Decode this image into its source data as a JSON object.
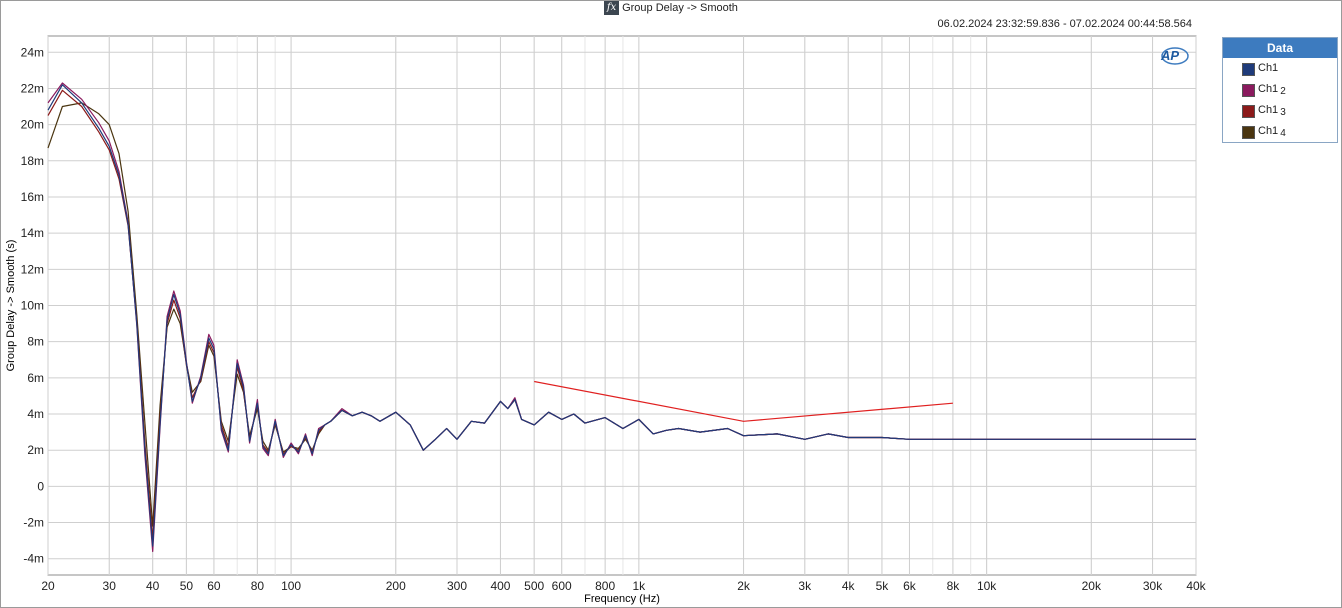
{
  "window": {
    "title": "Group Delay -> Smooth",
    "fx_icon": "fx",
    "timestamp": "06.02.2024 23:32:59.836 - 07.02.2024 00:44:58.564"
  },
  "logo": {
    "text": "AP"
  },
  "legend": {
    "header": "Data",
    "items": [
      {
        "label": "Ch1",
        "index": "",
        "color": "#1f3b7a"
      },
      {
        "label": "Ch1",
        "index": "2",
        "color": "#8a1a5e"
      },
      {
        "label": "Ch1",
        "index": "3",
        "color": "#8b1a1a"
      },
      {
        "label": "Ch1",
        "index": "4",
        "color": "#4a3510"
      }
    ]
  },
  "chart_data": {
    "type": "line",
    "xscale": "log",
    "xlabel": "Frequency (Hz)",
    "ylabel": "Group Delay -> Smooth (s)",
    "xlim": [
      20,
      40000
    ],
    "ylim": [
      -0.0049,
      0.0249
    ],
    "x_ticks": [
      {
        "v": 20,
        "l": "20"
      },
      {
        "v": 30,
        "l": "30"
      },
      {
        "v": 40,
        "l": "40"
      },
      {
        "v": 50,
        "l": "50"
      },
      {
        "v": 60,
        "l": "60"
      },
      {
        "v": 80,
        "l": "80"
      },
      {
        "v": 100,
        "l": "100"
      },
      {
        "v": 200,
        "l": "200"
      },
      {
        "v": 300,
        "l": "300"
      },
      {
        "v": 400,
        "l": "400"
      },
      {
        "v": 500,
        "l": "500"
      },
      {
        "v": 600,
        "l": "600"
      },
      {
        "v": 800,
        "l": "800"
      },
      {
        "v": 1000,
        "l": "1k"
      },
      {
        "v": 2000,
        "l": "2k"
      },
      {
        "v": 3000,
        "l": "3k"
      },
      {
        "v": 4000,
        "l": "4k"
      },
      {
        "v": 5000,
        "l": "5k"
      },
      {
        "v": 6000,
        "l": "6k"
      },
      {
        "v": 8000,
        "l": "8k"
      },
      {
        "v": 10000,
        "l": "10k"
      },
      {
        "v": 20000,
        "l": "20k"
      },
      {
        "v": 30000,
        "l": "30k"
      },
      {
        "v": 40000,
        "l": "40k"
      }
    ],
    "y_ticks": [
      {
        "v": 0.024,
        "l": "24m"
      },
      {
        "v": 0.022,
        "l": "22m"
      },
      {
        "v": 0.02,
        "l": "20m"
      },
      {
        "v": 0.018,
        "l": "18m"
      },
      {
        "v": 0.016,
        "l": "16m"
      },
      {
        "v": 0.014,
        "l": "14m"
      },
      {
        "v": 0.012,
        "l": "12m"
      },
      {
        "v": 0.01,
        "l": "10m"
      },
      {
        "v": 0.008,
        "l": "8m"
      },
      {
        "v": 0.006,
        "l": "6m"
      },
      {
        "v": 0.004,
        "l": "4m"
      },
      {
        "v": 0.002,
        "l": "2m"
      },
      {
        "v": 0,
        "l": "0"
      },
      {
        "v": -0.002,
        "l": "-2m"
      },
      {
        "v": -0.004,
        "l": "-4m"
      }
    ],
    "grid": true,
    "legend_position": "right",
    "x": [
      20,
      22,
      25,
      28,
      30,
      32,
      34,
      36,
      38,
      40,
      42,
      44,
      46,
      48,
      50,
      52,
      55,
      58,
      60,
      63,
      66,
      70,
      73,
      76,
      80,
      83,
      86,
      90,
      95,
      100,
      105,
      110,
      115,
      120,
      125,
      130,
      140,
      150,
      160,
      170,
      180,
      200,
      220,
      240,
      260,
      280,
      300,
      330,
      360,
      400,
      420,
      440,
      460,
      500,
      550,
      600,
      650,
      700,
      800,
      900,
      1000,
      1100,
      1200,
      1300,
      1500,
      1800,
      2000,
      2500,
      3000,
      3500,
      4000,
      5000,
      6000,
      8000,
      10000,
      15000,
      20000,
      30000,
      40000
    ],
    "series": [
      {
        "name": "Ch1",
        "values": [
          0.0208,
          0.0222,
          0.0212,
          0.0198,
          0.0188,
          0.0172,
          0.0145,
          0.009,
          0.002,
          -0.0033,
          0.0035,
          0.0092,
          0.0106,
          0.0095,
          0.0068,
          0.0047,
          0.006,
          0.0082,
          0.0076,
          0.0032,
          0.002,
          0.0068,
          0.0055,
          0.0025,
          0.0046,
          0.0022,
          0.0018,
          0.0036,
          0.0017,
          0.0023,
          0.0019,
          0.0028,
          0.0018,
          0.0031,
          0.0034,
          0.0036,
          0.0042,
          0.0039,
          0.0041,
          0.0039,
          0.0036,
          0.0041,
          0.0034,
          0.002,
          0.0026,
          0.0032,
          0.0026,
          0.0036,
          0.0035,
          0.0047,
          0.0043,
          0.0048,
          0.0037,
          0.0034,
          0.0041,
          0.0037,
          0.004,
          0.0035,
          0.0038,
          0.0032,
          0.0037,
          0.0029,
          0.0031,
          0.0032,
          0.003,
          0.0032,
          0.0028,
          0.0029,
          0.0026,
          0.0029,
          0.0027,
          0.0027,
          0.0026,
          0.0026,
          0.0026,
          0.0026,
          0.0026,
          0.0026,
          0.0026
        ]
      },
      {
        "name": "Ch1 2",
        "values": [
          0.0212,
          0.0223,
          0.0214,
          0.0201,
          0.0191,
          0.0174,
          0.0146,
          0.0089,
          0.0017,
          -0.0036,
          0.0033,
          0.0094,
          0.0108,
          0.0097,
          0.0069,
          0.0046,
          0.0061,
          0.0084,
          0.0078,
          0.0031,
          0.0019,
          0.007,
          0.0056,
          0.0024,
          0.0048,
          0.0021,
          0.0017,
          0.0037,
          0.0016,
          0.0024,
          0.0018,
          0.0029,
          0.0017,
          0.0032,
          0.0034,
          0.0036,
          0.0043,
          0.0039,
          0.0041,
          0.0039,
          0.0036,
          0.0041,
          0.0034,
          0.002,
          0.0026,
          0.0032,
          0.0026,
          0.0036,
          0.0035,
          0.0047,
          0.0043,
          0.0049,
          0.0037,
          0.0034,
          0.0041,
          0.0037,
          0.004,
          0.0035,
          0.0038,
          0.0032,
          0.0037,
          0.0029,
          0.0031,
          0.0032,
          0.003,
          0.0032,
          0.0028,
          0.0029,
          0.0026,
          0.0029,
          0.0027,
          0.0027,
          0.0026,
          0.0026,
          0.0026,
          0.0026,
          0.0026,
          0.0026,
          0.0026
        ]
      },
      {
        "name": "Ch1 3",
        "values": [
          0.0205,
          0.0219,
          0.021,
          0.0196,
          0.0186,
          0.017,
          0.0144,
          0.0091,
          0.0024,
          -0.0029,
          0.0038,
          0.009,
          0.0103,
          0.0093,
          0.0067,
          0.0049,
          0.0059,
          0.008,
          0.0074,
          0.0034,
          0.0022,
          0.0066,
          0.0053,
          0.0026,
          0.0045,
          0.0023,
          0.0019,
          0.0035,
          0.0018,
          0.0022,
          0.002,
          0.0027,
          0.0019,
          0.003,
          0.0034,
          0.0036,
          0.0042,
          0.0039,
          0.0041,
          0.0039,
          0.0036,
          0.0041,
          0.0034,
          0.002,
          0.0026,
          0.0032,
          0.0026,
          0.0036,
          0.0035,
          0.0047,
          0.0043,
          0.0048,
          0.0037,
          0.0034,
          0.0041,
          0.0037,
          0.004,
          0.0035,
          0.0038,
          0.0032,
          0.0037,
          0.0029,
          0.0031,
          0.0032,
          0.003,
          0.0032,
          0.0028,
          0.0029,
          0.0026,
          0.0029,
          0.0027,
          0.0027,
          0.0026,
          0.0026,
          0.0026,
          0.0026,
          0.0026,
          0.0026,
          0.0026
        ]
      },
      {
        "name": "Ch1 4",
        "values": [
          0.0187,
          0.021,
          0.0212,
          0.0206,
          0.02,
          0.0184,
          0.0152,
          0.0095,
          0.0035,
          -0.0022,
          0.0045,
          0.0088,
          0.0098,
          0.009,
          0.0068,
          0.0052,
          0.0058,
          0.0078,
          0.0072,
          0.0036,
          0.0025,
          0.0062,
          0.0052,
          0.0028,
          0.0043,
          0.0025,
          0.002,
          0.0034,
          0.0019,
          0.0022,
          0.0021,
          0.0026,
          0.002,
          0.0029,
          0.0034,
          0.0036,
          0.0042,
          0.0039,
          0.0041,
          0.0039,
          0.0036,
          0.0041,
          0.0034,
          0.002,
          0.0026,
          0.0032,
          0.0026,
          0.0036,
          0.0035,
          0.0047,
          0.0043,
          0.0048,
          0.0037,
          0.0034,
          0.0041,
          0.0037,
          0.004,
          0.0035,
          0.0038,
          0.0032,
          0.0037,
          0.0029,
          0.0031,
          0.0032,
          0.003,
          0.0032,
          0.0028,
          0.0029,
          0.0026,
          0.0029,
          0.0027,
          0.0027,
          0.0026,
          0.0026,
          0.0026,
          0.0026,
          0.0026,
          0.0026,
          0.0026
        ]
      }
    ],
    "annotation_line": {
      "color": "#e02020",
      "points": [
        [
          500,
          0.0058
        ],
        [
          2000,
          0.0036
        ],
        [
          8000,
          0.0046
        ]
      ]
    }
  }
}
